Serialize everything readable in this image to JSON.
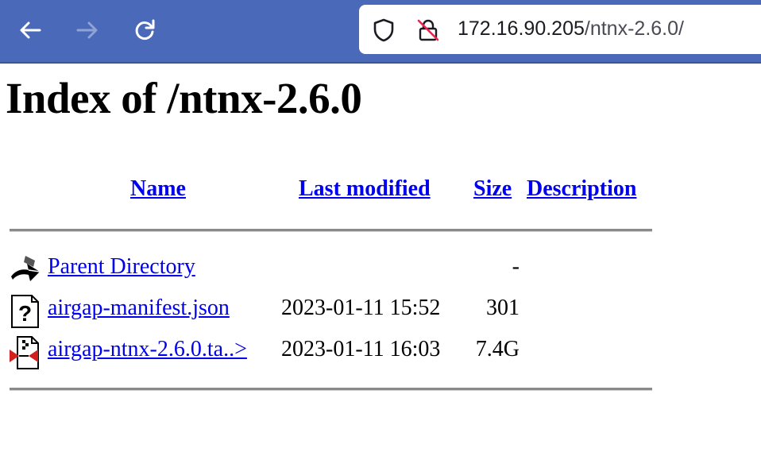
{
  "browser": {
    "url_host": "172.16.90.205",
    "url_path": "/ntnx-2.6.0/",
    "icons": [
      "back-arrow-icon",
      "forward-arrow-icon",
      "reload-icon",
      "shield-icon",
      "insecure-lock-icon"
    ]
  },
  "page": {
    "title": "Index of /ntnx-2.6.0"
  },
  "table": {
    "headers": {
      "name": "Name",
      "last_modified": "Last modified",
      "size": "Size",
      "description": "Description"
    },
    "rows": [
      {
        "icon": "parent-directory-icon",
        "name": "Parent Directory",
        "modified": "",
        "size": "-"
      },
      {
        "icon": "unknown-file-icon",
        "name": "airgap-manifest.json",
        "modified": "2023-01-11 15:52",
        "size": "301"
      },
      {
        "icon": "compressed-file-icon",
        "name": "airgap-ntnx-2.6.0.ta..>",
        "modified": "2023-01-11 16:03",
        "size": "7.4G"
      }
    ]
  }
}
